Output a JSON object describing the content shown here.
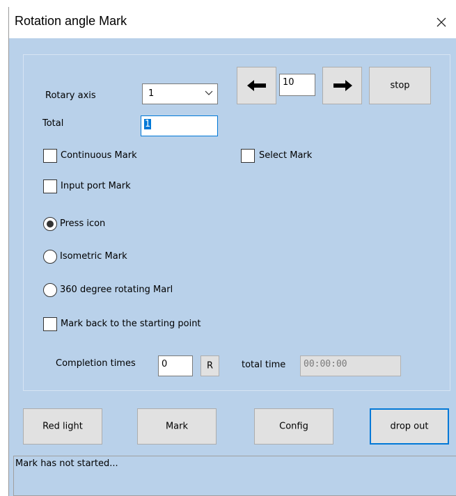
{
  "window": {
    "title": "Rotation angle Mark"
  },
  "rotary_axis": {
    "label": "Rotary axis",
    "selected": "1"
  },
  "stepper": {
    "value": "10"
  },
  "stop_label": "stop",
  "total": {
    "label": "Total",
    "value": "1"
  },
  "checkboxes": {
    "continuous_mark": "Continuous Mark",
    "select_mark": "Select Mark",
    "input_port_mark": "Input port Mark",
    "mark_back": "Mark back to the starting point"
  },
  "radios": {
    "press_icon": "Press icon",
    "isometric_mark": "Isometric Mark",
    "rotating_mark": "360 degree rotating Marl"
  },
  "completion": {
    "label": "Completion times",
    "value": "0",
    "reset_label": "R"
  },
  "total_time": {
    "label": "total time",
    "value": "00:00:00"
  },
  "buttons": {
    "red_light": "Red light",
    "mark": "Mark",
    "config": "Config",
    "drop_out": "drop out"
  },
  "status": {
    "text": "Mark has not started..."
  },
  "colors": {
    "window_bg": "#b9d1ea",
    "button_bg": "#e1e1e1",
    "focus": "#0078d7"
  },
  "icons": {
    "close": "close-icon",
    "left_arrow": "arrow-left-icon",
    "right_arrow": "arrow-right-icon",
    "dropdown": "chevron-down-icon"
  }
}
